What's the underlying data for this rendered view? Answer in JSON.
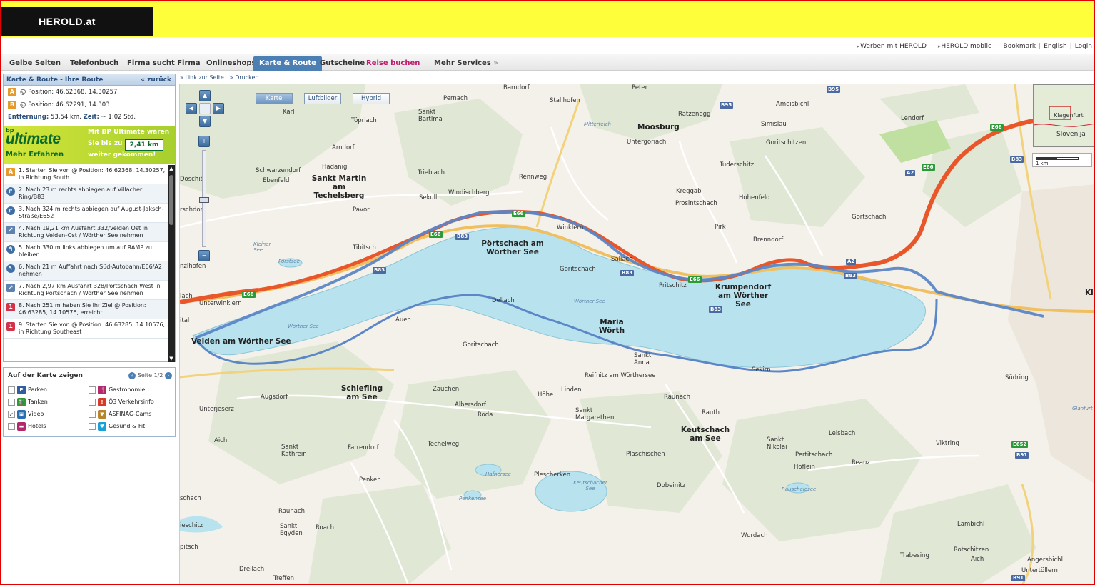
{
  "header": {
    "logo": "HEROLD.at"
  },
  "util_links": {
    "werben": "Werben mit HEROLD",
    "mobile": "HEROLD mobile",
    "bookmark": "Bookmark",
    "english": "English",
    "login": "Login"
  },
  "nav": {
    "tabs": [
      {
        "label": "Gelbe Seiten"
      },
      {
        "label": "Telefonbuch"
      },
      {
        "label": "Firma sucht Firma"
      },
      {
        "label": "Onlineshops"
      },
      {
        "label": "Karte & Route"
      },
      {
        "label": "Gutscheine"
      },
      {
        "label": "Reise buchen"
      },
      {
        "label": "Mehr Services"
      }
    ]
  },
  "route_panel": {
    "title": "Karte & Route - Ihre Route",
    "back": "zurück",
    "a_badge": "A",
    "b_badge": "B",
    "from": "@ Position: 46.62368, 14.30257",
    "to": "@ Position: 46.62291, 14.303",
    "distance_label": "Entfernung:",
    "distance_value": "53,54 km,",
    "time_label": "Zeit:",
    "time_value": "~ 1:02 Std."
  },
  "ad": {
    "bp": "bp",
    "logo": "ultimate",
    "more": "Mehr Erfahren",
    "line1": "Mit BP Ultimate wären",
    "line2": "Sie bis zu",
    "line3": "weiter gekommen!",
    "km": "2,41 km"
  },
  "steps": [
    {
      "icon": "A",
      "text": "1. Starten Sie von @ Position: 46.62368, 14.30257, in Richtung South"
    },
    {
      "icon": "↱",
      "text": "2. Nach 23 m rechts abbiegen auf Villacher Ring/B83"
    },
    {
      "icon": "↱",
      "text": "3. Nach 324 m rechts abbiegen auf August-Jaksch-Straße/E652"
    },
    {
      "icon": "↗",
      "text": "4. Nach 19,21 km Ausfahrt 332/Velden Ost in Richtung Velden-Ost / Wörther See nehmen"
    },
    {
      "icon": "↰",
      "text": "5. Nach 330 m links abbiegen um auf RAMP zu bleiben"
    },
    {
      "icon": "↖",
      "text": "6. Nach 21 m Auffahrt nach Süd-Autobahn/E66/A2 nehmen"
    },
    {
      "icon": "↗",
      "text": "7. Nach 2,97 km Ausfahrt 328/Pörtschach West in Richtung Pörtschach / Wörther See nehmen"
    },
    {
      "icon": "1",
      "text": "8. Nach 251 m haben Sie Ihr Ziel @ Position: 46.63285, 14.10576, erreicht"
    },
    {
      "icon": "1",
      "text": "9. Starten Sie von @ Position: 46.63285, 14.10576, in Richtung Southeast"
    }
  ],
  "poi": {
    "title": "Auf der Karte zeigen",
    "pager": "Seite 1/2",
    "items": [
      {
        "label": "Parken",
        "checked": false,
        "icon": "P",
        "color": "#2f5fa0"
      },
      {
        "label": "Gastronomie",
        "checked": false,
        "icon": "🍴",
        "color": "#b3276b"
      },
      {
        "label": "Tanken",
        "checked": false,
        "icon": "⛽",
        "color": "#2d9a3a"
      },
      {
        "label": "Ö3 Verkehrsinfo",
        "checked": false,
        "icon": "!",
        "color": "#d63a2a"
      },
      {
        "label": "Video",
        "checked": true,
        "icon": "▣",
        "color": "#2a6fb3"
      },
      {
        "label": "ASFINAG-Cams",
        "checked": false,
        "icon": "▼",
        "color": "#b8862a"
      },
      {
        "label": "Hotels",
        "checked": false,
        "icon": "▬",
        "color": "#b3276b"
      },
      {
        "label": "Gesund & Fit",
        "checked": false,
        "icon": "♥",
        "color": "#1a9fd6"
      }
    ]
  },
  "map_toolbar": {
    "link": "Link zur Seite",
    "print": "Drucken"
  },
  "map_types": [
    "Karte",
    "Luftbilder",
    "Hybrid"
  ],
  "scale": "1 km",
  "minimap": {
    "city": "Klagenfurt",
    "country": "Slovenija"
  },
  "places": {
    "barndorf": "Barndorf",
    "pernach": "Pernach",
    "stallhofen": "Stallhofen",
    "peter": "Peter",
    "ameisbichl": "Ameisbichl",
    "lendorf": "Lendorf",
    "karl": "Karl",
    "sankt_bartlma": "Sankt Bartlmä",
    "toepriach": "Töpriach",
    "moosburg": "Moosburg",
    "ratzenegg": "Ratzenegg",
    "simislau": "Simislau",
    "untergoeriach": "Untergöriach",
    "goritschitzen1": "Goritschitzen",
    "arndorf": "Arndorf",
    "hadanig": "Hadanig",
    "schwarzendorf": "Schwarzendorf",
    "ebenfeld": "Ebenfeld",
    "sankt_martin": "Sankt Martin am Techelsberg",
    "trieblach": "Trieblach",
    "rennweg": "Rennweg",
    "tuderschitz": "Tuderschitz",
    "kreggab": "Kreggab",
    "hohenfeld": "Hohenfeld",
    "prosintschach": "Prosintschach",
    "sekull": "Sekull",
    "windischberg": "Windischberg",
    "goertschach": "Görtschach",
    "doeschitz": "Döschitz",
    "pavor": "Pavor",
    "rschdorf": "rschdorf",
    "winklern": "Winklern",
    "pirk": "Pirk",
    "brenndorf": "Brenndorf",
    "poertschach": "Pörtschach am Wörther See",
    "tibitsch": "Tibitsch",
    "sallach": "Sallach",
    "goritschach1": "Goritschach",
    "pritschitz": "Pritschitz",
    "krumpendorf": "Krumpendorf am Wörther See",
    "unterwinklern": "Unterwinklern",
    "dellach": "Dellach",
    "maria_woerth": "Maria Wörth",
    "auen": "Auen",
    "velden": "Velden am Wörther See",
    "goritschach2": "Goritschach",
    "sankt_anna": "Sankt Anna",
    "sekirn": "Sekirn",
    "reifnitz": "Reifnitz am Wörthersee",
    "augsdorf": "Augsdorf",
    "schiefling": "Schiefling am See",
    "zauchen": "Zauchen",
    "hoehe": "Höhe",
    "linden": "Linden",
    "raunach1": "Raunach",
    "suedring": "Südring",
    "unterjeserz": "Unterjeserz",
    "albersdorf": "Albersdorf",
    "roda": "Roda",
    "sankt_margarethen": "Sankt Margarethen",
    "rauth": "Rauth",
    "keutschach": "Keutschach am See",
    "leisbach": "Leisbach",
    "aich1": "Aich",
    "sankt_kathrein": "Sankt Kathrein",
    "farrendorf": "Farrendorf",
    "techelweg": "Techelweg",
    "sankt_nikolai": "Sankt Nikolai",
    "pertitschach": "Pertitschach",
    "viktring": "Viktring",
    "plaschischen": "Plaschischen",
    "hoeflein": "Höflein",
    "reauz": "Reauz",
    "plescherken": "Plescherken",
    "penken": "Penken",
    "dobeinitz": "Dobeinitz",
    "raunach2": "Raunach",
    "sankt_egyden": "Sankt Egyden",
    "roach": "Roach",
    "wurdach": "Wurdach",
    "lambichl": "Lambichl",
    "rotschitzen": "Rotschitzen",
    "trabesing": "Trabesing",
    "aich2": "Aich",
    "angersbichl": "Angersbichl",
    "unterteollern": "Untertöllern",
    "dreilach": "Dreilach",
    "treffen": "Treffen",
    "schach": "schach",
    "ieschitz": "ieschitz",
    "pitsch": "pitsch",
    "nzlhofen": "nzlhofen",
    "iach": "iach",
    "ital": "ital",
    "kl": "Kl"
  },
  "lake_labels": {
    "kleiner_see": "Kleiner See",
    "forstsee": "Forstsee",
    "woerther1": "Wörther See",
    "woerther2": "Wörther See",
    "hafnersee": "Hafnersee",
    "keutschacher": "Keutschacher See",
    "penkensee": "Penkensee",
    "rauschelesee": "Rauschelesee",
    "mitterteich": "Mitterteich",
    "glanfurt": "Glanfurt"
  },
  "roads": {
    "b95a": "B95",
    "b95b": "B95",
    "b83a": "B83",
    "b83b": "B83",
    "b83c": "B83",
    "b83d": "B83",
    "b83e": "B83",
    "b83f": "B83",
    "e66a": "E66",
    "e66b": "E66",
    "e66c": "E66",
    "e66d": "E66",
    "e66e": "E66",
    "e66f": "E66",
    "a2a": "A2",
    "a2b": "A2",
    "e652": "E652",
    "b91": "B91",
    "b91b": "B91"
  },
  "colors": {
    "brand_yellow": "#fefe3a",
    "route_blue": "#5b86c7",
    "autobahn_orange": "#e8562a",
    "lake": "#b8e3ee"
  }
}
